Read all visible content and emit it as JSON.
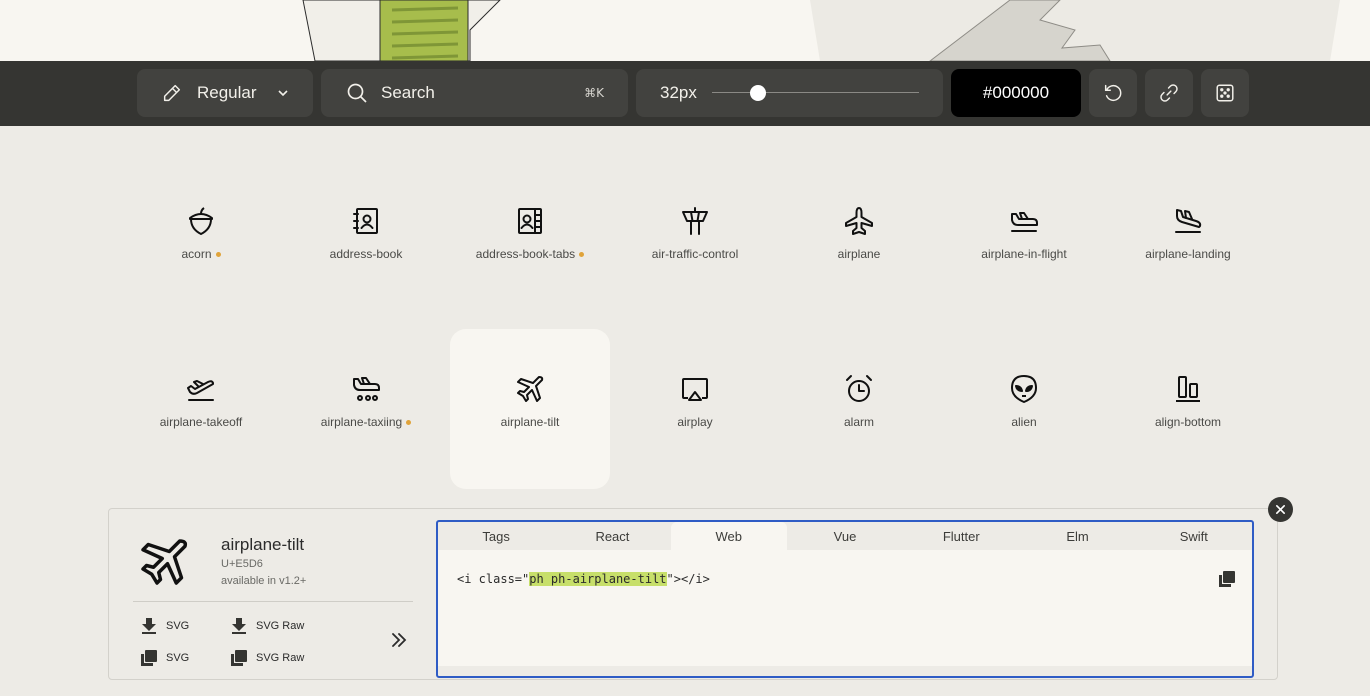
{
  "toolbar": {
    "weight": {
      "label": "Regular",
      "icon": "pencil-icon"
    },
    "search": {
      "placeholder": "Search",
      "shortcut": "⌘K"
    },
    "size": {
      "label": "32px",
      "slider_fraction": 0.22
    },
    "color": {
      "value": "#000000"
    },
    "buttons": [
      "reset-icon",
      "link-icon",
      "dice-icon"
    ]
  },
  "icons": [
    {
      "name": "acorn",
      "new": true
    },
    {
      "name": "address-book",
      "new": false
    },
    {
      "name": "address-book-tabs",
      "new": true
    },
    {
      "name": "air-traffic-control",
      "new": false
    },
    {
      "name": "airplane",
      "new": false
    },
    {
      "name": "airplane-in-flight",
      "new": false
    },
    {
      "name": "airplane-landing",
      "new": false
    },
    {
      "name": "airplane-takeoff",
      "new": false
    },
    {
      "name": "airplane-taxiing",
      "new": true
    },
    {
      "name": "airplane-tilt",
      "new": false,
      "selected": true
    },
    {
      "name": "airplay",
      "new": false
    },
    {
      "name": "alarm",
      "new": false
    },
    {
      "name": "alien",
      "new": false
    },
    {
      "name": "align-bottom",
      "new": false
    }
  ],
  "detail": {
    "name": "airplane-tilt",
    "codepoint": "U+E5D6",
    "version": "available in v1.2+",
    "downloads": [
      {
        "label": "SVG",
        "action": "download"
      },
      {
        "label": "SVG Raw",
        "action": "download"
      },
      {
        "label": "SVG",
        "action": "copy"
      },
      {
        "label": "SVG Raw",
        "action": "copy"
      }
    ]
  },
  "code": {
    "tabs": [
      "Tags",
      "React",
      "Web",
      "Vue",
      "Flutter",
      "Elm",
      "Swift"
    ],
    "active_tab": "Web",
    "prefix": "<i class=\"",
    "highlight": "ph ph-airplane-tilt",
    "suffix": "\"></i>"
  },
  "colors": {
    "background": "#edebe6",
    "toolbar": "#353532",
    "accent_dot": "#e0a33a",
    "focus_border": "#2f5cc5",
    "code_highlight": "#c7df6a"
  }
}
